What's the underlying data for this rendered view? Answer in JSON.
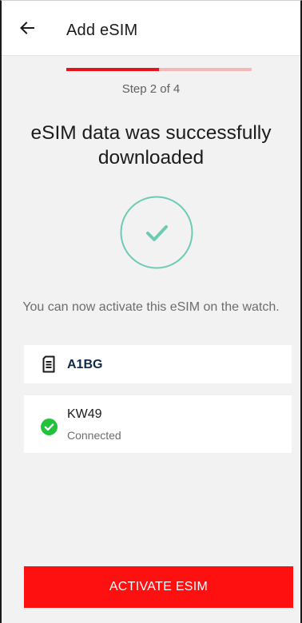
{
  "app_bar": {
    "title": "Add eSIM",
    "back_icon": "arrow-left-icon"
  },
  "progress": {
    "step_label": "Step 2 of 4",
    "fraction": 0.5,
    "colors": {
      "fill": "#e4141a",
      "track": "#f4b8b8"
    }
  },
  "success": {
    "headline": "eSIM data was successfully downloaded",
    "icon": "checkmark-circle-icon",
    "accent": "#6ccbb4",
    "message": "You can now activate this eSIM on the watch."
  },
  "sim_card": {
    "icon": "sim-card-icon",
    "name": "A1BG"
  },
  "watch_card": {
    "icon": "connected-check-icon",
    "name": "KW49",
    "status": "Connected",
    "status_color": "#21c33b"
  },
  "actions": {
    "activate_label": "ACTIVATE ESIM",
    "activate_color": "#fe1010"
  }
}
